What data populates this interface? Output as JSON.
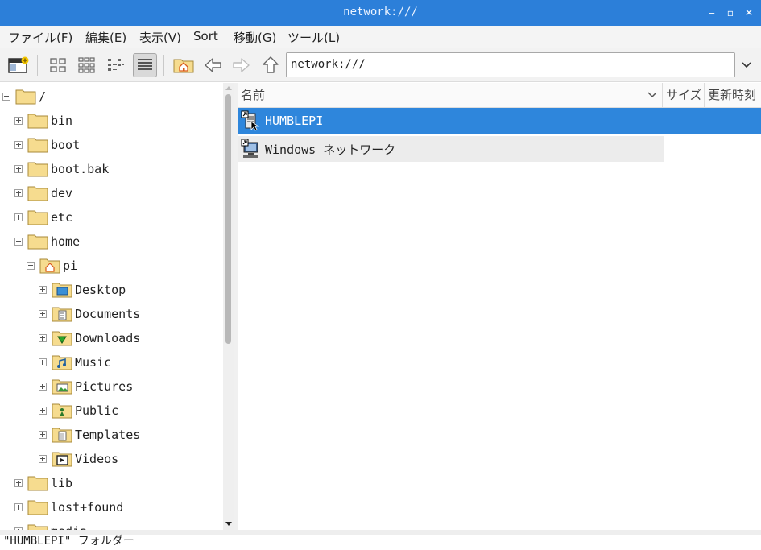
{
  "window": {
    "title": "network:///",
    "btn_minimize": "‒",
    "btn_maximize": "▫",
    "btn_close": "✕"
  },
  "menu": [
    "ファイル(F)",
    "編集(E)",
    "表示(V)",
    "Sort",
    "移動(G)",
    "ツール(L)"
  ],
  "toolbar": {
    "location": "network:///"
  },
  "tree": [
    {
      "label": "/",
      "depth": 0,
      "expander": "minus",
      "icon": "folder"
    },
    {
      "label": "bin",
      "depth": 1,
      "expander": "plus",
      "icon": "folder"
    },
    {
      "label": "boot",
      "depth": 1,
      "expander": "plus",
      "icon": "folder"
    },
    {
      "label": "boot.bak",
      "depth": 1,
      "expander": "plus",
      "icon": "folder"
    },
    {
      "label": "dev",
      "depth": 1,
      "expander": "plus",
      "icon": "folder"
    },
    {
      "label": "etc",
      "depth": 1,
      "expander": "plus",
      "icon": "folder"
    },
    {
      "label": "home",
      "depth": 1,
      "expander": "minus",
      "icon": "folder"
    },
    {
      "label": "pi",
      "depth": 2,
      "expander": "minus",
      "icon": "home-folder"
    },
    {
      "label": "Desktop",
      "depth": 3,
      "expander": "plus",
      "icon": "desktop-folder"
    },
    {
      "label": "Documents",
      "depth": 3,
      "expander": "plus",
      "icon": "documents-folder"
    },
    {
      "label": "Downloads",
      "depth": 3,
      "expander": "plus",
      "icon": "downloads-folder"
    },
    {
      "label": "Music",
      "depth": 3,
      "expander": "plus",
      "icon": "music-folder"
    },
    {
      "label": "Pictures",
      "depth": 3,
      "expander": "plus",
      "icon": "pictures-folder"
    },
    {
      "label": "Public",
      "depth": 3,
      "expander": "plus",
      "icon": "public-folder"
    },
    {
      "label": "Templates",
      "depth": 3,
      "expander": "plus",
      "icon": "templates-folder"
    },
    {
      "label": "Videos",
      "depth": 3,
      "expander": "plus",
      "icon": "videos-folder"
    },
    {
      "label": "lib",
      "depth": 1,
      "expander": "plus",
      "icon": "folder"
    },
    {
      "label": "lost+found",
      "depth": 1,
      "expander": "plus",
      "icon": "folder"
    },
    {
      "label": "media",
      "depth": 1,
      "expander": "plus",
      "icon": "folder"
    }
  ],
  "columns": {
    "name": "名前",
    "size": "サイズ",
    "modified": "更新時刻"
  },
  "files": [
    {
      "label": "HUMBLEPI",
      "selected": true,
      "icon": "network-server-icon"
    },
    {
      "label": "Windows ネットワーク",
      "selected": false,
      "icon": "network-workgroup-icon"
    }
  ],
  "status": "\"HUMBLEPI\" フォルダー",
  "colors": {
    "titlebar": "#2c7fd9",
    "selection": "#2e86dc",
    "folder": "#f6dc8f"
  }
}
